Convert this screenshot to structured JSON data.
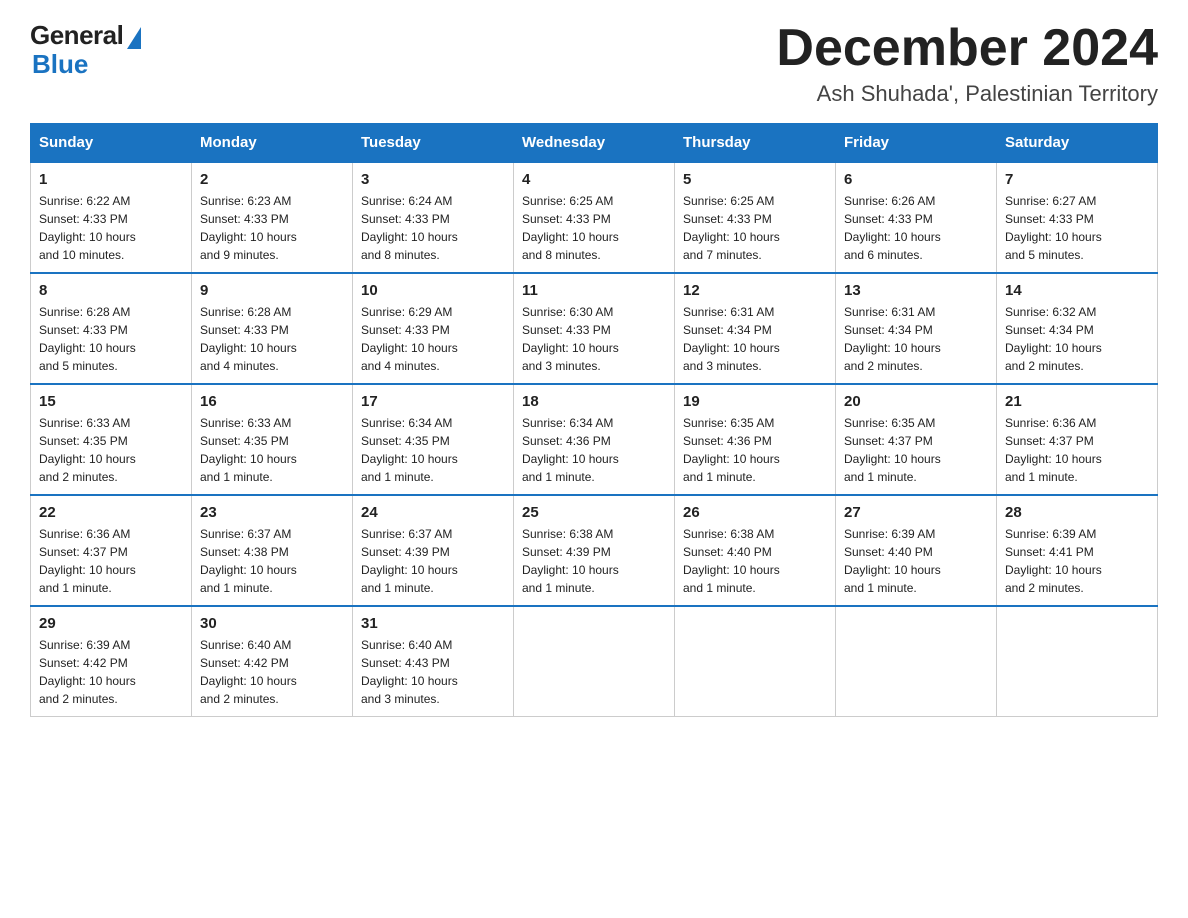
{
  "logo": {
    "general": "General",
    "blue": "Blue"
  },
  "header": {
    "title": "December 2024",
    "subtitle": "Ash Shuhada', Palestinian Territory"
  },
  "days_of_week": [
    "Sunday",
    "Monday",
    "Tuesday",
    "Wednesday",
    "Thursday",
    "Friday",
    "Saturday"
  ],
  "weeks": [
    [
      {
        "day": "1",
        "sunrise": "6:22 AM",
        "sunset": "4:33 PM",
        "daylight": "10 hours and 10 minutes."
      },
      {
        "day": "2",
        "sunrise": "6:23 AM",
        "sunset": "4:33 PM",
        "daylight": "10 hours and 9 minutes."
      },
      {
        "day": "3",
        "sunrise": "6:24 AM",
        "sunset": "4:33 PM",
        "daylight": "10 hours and 8 minutes."
      },
      {
        "day": "4",
        "sunrise": "6:25 AM",
        "sunset": "4:33 PM",
        "daylight": "10 hours and 8 minutes."
      },
      {
        "day": "5",
        "sunrise": "6:25 AM",
        "sunset": "4:33 PM",
        "daylight": "10 hours and 7 minutes."
      },
      {
        "day": "6",
        "sunrise": "6:26 AM",
        "sunset": "4:33 PM",
        "daylight": "10 hours and 6 minutes."
      },
      {
        "day": "7",
        "sunrise": "6:27 AM",
        "sunset": "4:33 PM",
        "daylight": "10 hours and 5 minutes."
      }
    ],
    [
      {
        "day": "8",
        "sunrise": "6:28 AM",
        "sunset": "4:33 PM",
        "daylight": "10 hours and 5 minutes."
      },
      {
        "day": "9",
        "sunrise": "6:28 AM",
        "sunset": "4:33 PM",
        "daylight": "10 hours and 4 minutes."
      },
      {
        "day": "10",
        "sunrise": "6:29 AM",
        "sunset": "4:33 PM",
        "daylight": "10 hours and 4 minutes."
      },
      {
        "day": "11",
        "sunrise": "6:30 AM",
        "sunset": "4:33 PM",
        "daylight": "10 hours and 3 minutes."
      },
      {
        "day": "12",
        "sunrise": "6:31 AM",
        "sunset": "4:34 PM",
        "daylight": "10 hours and 3 minutes."
      },
      {
        "day": "13",
        "sunrise": "6:31 AM",
        "sunset": "4:34 PM",
        "daylight": "10 hours and 2 minutes."
      },
      {
        "day": "14",
        "sunrise": "6:32 AM",
        "sunset": "4:34 PM",
        "daylight": "10 hours and 2 minutes."
      }
    ],
    [
      {
        "day": "15",
        "sunrise": "6:33 AM",
        "sunset": "4:35 PM",
        "daylight": "10 hours and 2 minutes."
      },
      {
        "day": "16",
        "sunrise": "6:33 AM",
        "sunset": "4:35 PM",
        "daylight": "10 hours and 1 minute."
      },
      {
        "day": "17",
        "sunrise": "6:34 AM",
        "sunset": "4:35 PM",
        "daylight": "10 hours and 1 minute."
      },
      {
        "day": "18",
        "sunrise": "6:34 AM",
        "sunset": "4:36 PM",
        "daylight": "10 hours and 1 minute."
      },
      {
        "day": "19",
        "sunrise": "6:35 AM",
        "sunset": "4:36 PM",
        "daylight": "10 hours and 1 minute."
      },
      {
        "day": "20",
        "sunrise": "6:35 AM",
        "sunset": "4:37 PM",
        "daylight": "10 hours and 1 minute."
      },
      {
        "day": "21",
        "sunrise": "6:36 AM",
        "sunset": "4:37 PM",
        "daylight": "10 hours and 1 minute."
      }
    ],
    [
      {
        "day": "22",
        "sunrise": "6:36 AM",
        "sunset": "4:37 PM",
        "daylight": "10 hours and 1 minute."
      },
      {
        "day": "23",
        "sunrise": "6:37 AM",
        "sunset": "4:38 PM",
        "daylight": "10 hours and 1 minute."
      },
      {
        "day": "24",
        "sunrise": "6:37 AM",
        "sunset": "4:39 PM",
        "daylight": "10 hours and 1 minute."
      },
      {
        "day": "25",
        "sunrise": "6:38 AM",
        "sunset": "4:39 PM",
        "daylight": "10 hours and 1 minute."
      },
      {
        "day": "26",
        "sunrise": "6:38 AM",
        "sunset": "4:40 PM",
        "daylight": "10 hours and 1 minute."
      },
      {
        "day": "27",
        "sunrise": "6:39 AM",
        "sunset": "4:40 PM",
        "daylight": "10 hours and 1 minute."
      },
      {
        "day": "28",
        "sunrise": "6:39 AM",
        "sunset": "4:41 PM",
        "daylight": "10 hours and 2 minutes."
      }
    ],
    [
      {
        "day": "29",
        "sunrise": "6:39 AM",
        "sunset": "4:42 PM",
        "daylight": "10 hours and 2 minutes."
      },
      {
        "day": "30",
        "sunrise": "6:40 AM",
        "sunset": "4:42 PM",
        "daylight": "10 hours and 2 minutes."
      },
      {
        "day": "31",
        "sunrise": "6:40 AM",
        "sunset": "4:43 PM",
        "daylight": "10 hours and 3 minutes."
      },
      null,
      null,
      null,
      null
    ]
  ],
  "labels": {
    "sunrise": "Sunrise:",
    "sunset": "Sunset:",
    "daylight": "Daylight:"
  }
}
